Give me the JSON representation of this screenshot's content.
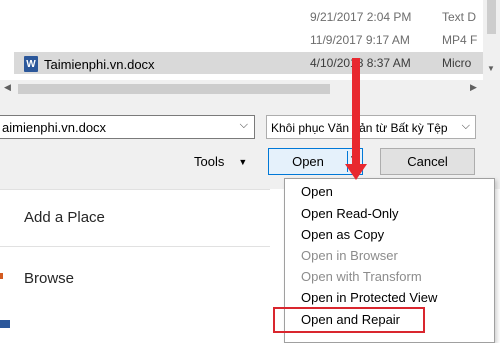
{
  "files": [
    {
      "name": "",
      "date": "9/21/2017 2:04 PM",
      "type": "Text D"
    },
    {
      "name": "",
      "date": "11/9/2017 9:17 AM",
      "type": "MP4 F"
    },
    {
      "name": "Taimienphi.vn.docx",
      "date": "4/10/2018 8:37 AM",
      "type": "Micro",
      "selected": true
    }
  ],
  "dialog": {
    "filename_value": "aimienphi.vn.docx",
    "filetype_value": "Khôi phục Văn bản từ Bất kỳ Tệp",
    "tools_label": "Tools",
    "open_label": "Open",
    "cancel_label": "Cancel"
  },
  "backstage": {
    "items": [
      "Add a Place",
      "Browse"
    ]
  },
  "open_menu": {
    "items": [
      {
        "label": "Open",
        "enabled": true
      },
      {
        "label": "Open Read-Only",
        "enabled": true
      },
      {
        "label": "Open as Copy",
        "enabled": true
      },
      {
        "label": "Open in Browser",
        "enabled": false
      },
      {
        "label": "Open with Transform",
        "enabled": false
      },
      {
        "label": "Open in Protected View",
        "enabled": true
      },
      {
        "label": "Open and Repair",
        "enabled": true
      }
    ]
  },
  "colors": {
    "highlight": "#d9262e",
    "arrow": "#e8282f",
    "accent": "#0078d7"
  },
  "icons": {
    "word_doc": "word-doc-icon",
    "dropdown": "chevron-down-icon"
  }
}
